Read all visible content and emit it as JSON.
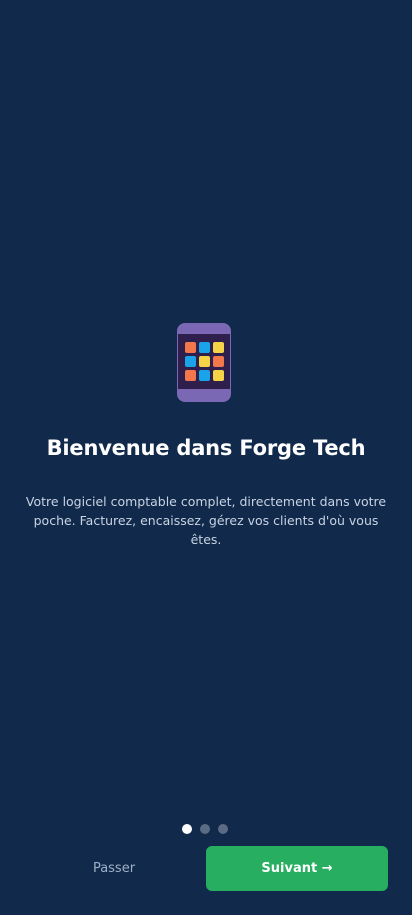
{
  "onboarding": {
    "title": "Bienvenue dans Forge Tech",
    "description": "Votre logiciel comptable complet, directement dans votre poche. Facturez, encaissez, gérez vos clients d'où vous êtes.",
    "illustration_icon": "mobile-phone-icon",
    "app_tile_colors": [
      "#f2784b",
      "#1aa3e8",
      "#f5d547",
      "#1aa3e8",
      "#f5d547",
      "#f2784b",
      "#f2784b",
      "#1aa3e8",
      "#f5d547"
    ],
    "pagination": {
      "total": 3,
      "current": 1
    },
    "skip_label": "Passer",
    "next_label": "Suivant →"
  },
  "colors": {
    "background": "#11294a",
    "accent": "#27ae60",
    "dot_active": "#ffffff",
    "dot_inactive": "#5b6b84"
  }
}
